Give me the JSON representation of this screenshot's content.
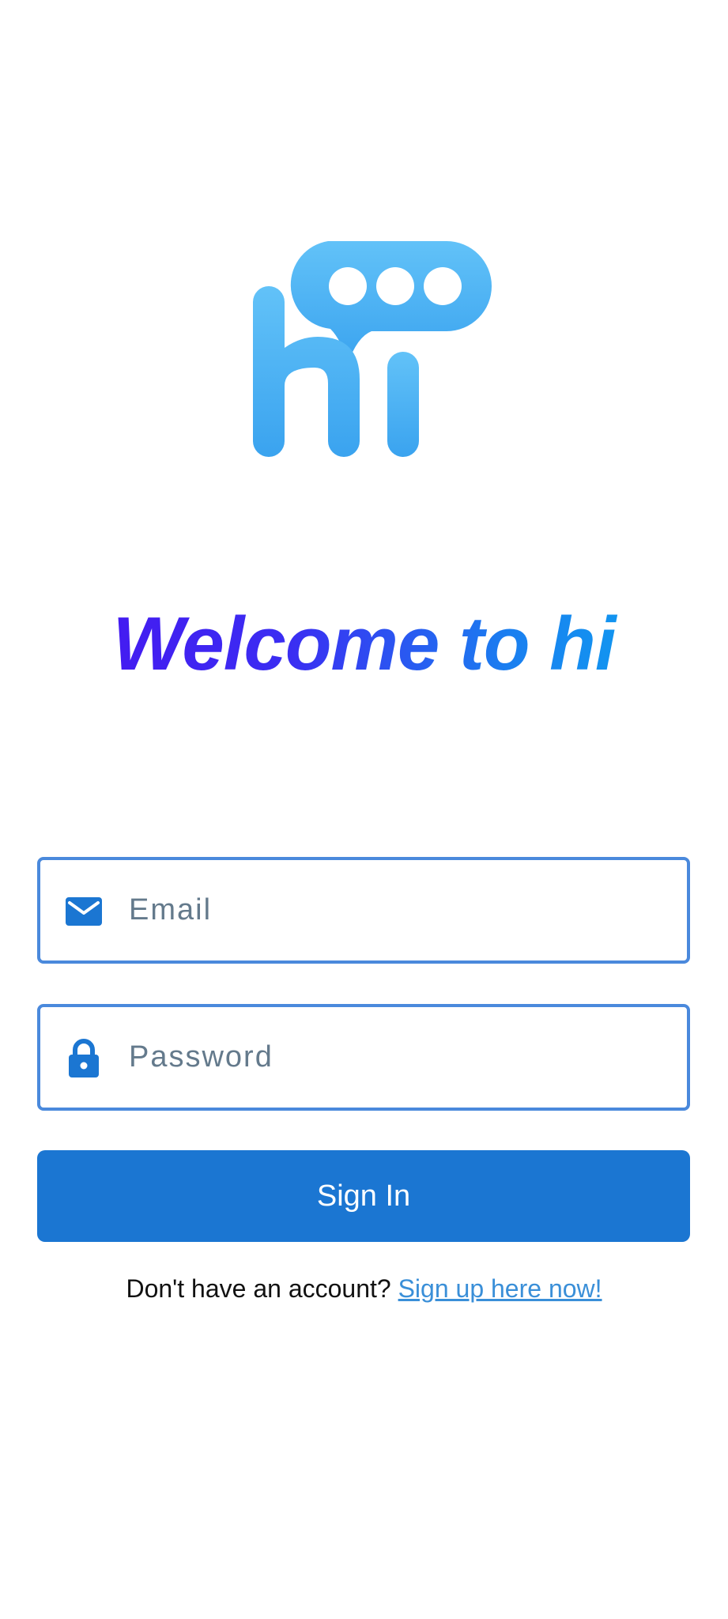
{
  "logo": {
    "icon": "hi-chat-bubble-logo",
    "color": "#4cb0f5"
  },
  "welcome": {
    "title": "Welcome to hi",
    "gradient_start": "#4a10f0",
    "gradient_end": "#0aaaf0"
  },
  "form": {
    "email": {
      "placeholder": "Email",
      "value": "",
      "icon": "mail-icon"
    },
    "password": {
      "placeholder": "Password",
      "value": "",
      "icon": "lock-icon"
    },
    "signin_label": "Sign In"
  },
  "signup": {
    "prompt": "Don't have an account?",
    "link_label": "Sign up here now!"
  },
  "colors": {
    "accent": "#1b76d2",
    "field_border": "#4a89dc",
    "link": "#3a8fd8"
  }
}
